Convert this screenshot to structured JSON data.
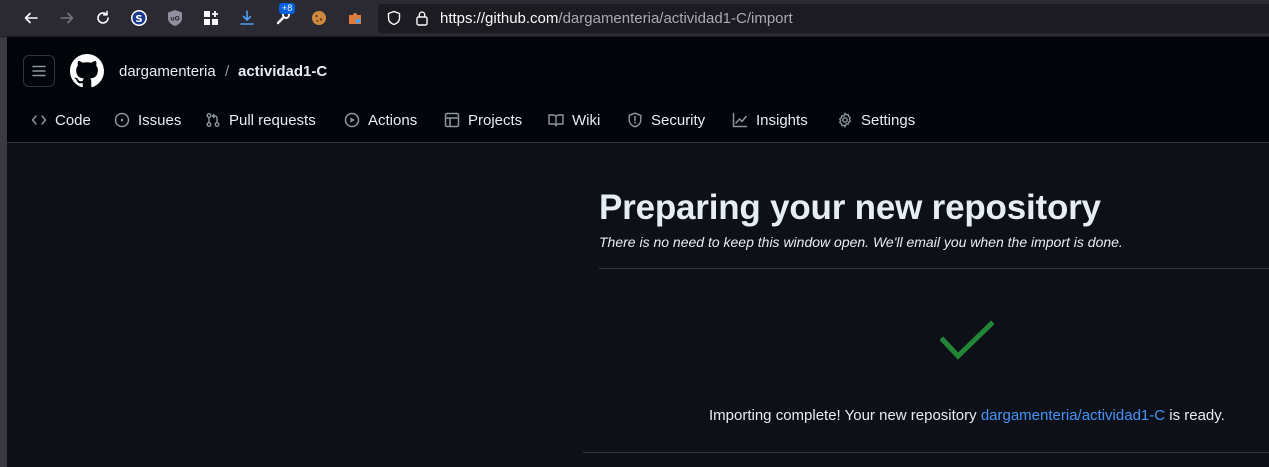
{
  "browser": {
    "url_host": "https://github.com",
    "url_path": "/dargamenteria/actividad1-C/import",
    "extensions_badge": "+8"
  },
  "repo": {
    "owner": "dargamenteria",
    "separator": "/",
    "name": "actividad1-C"
  },
  "tabs": [
    {
      "label": "Code",
      "icon": "code-icon"
    },
    {
      "label": "Issues",
      "icon": "issue-icon"
    },
    {
      "label": "Pull requests",
      "icon": "pull-request-icon"
    },
    {
      "label": "Actions",
      "icon": "play-icon"
    },
    {
      "label": "Projects",
      "icon": "table-icon"
    },
    {
      "label": "Wiki",
      "icon": "book-icon"
    },
    {
      "label": "Security",
      "icon": "shield-icon"
    },
    {
      "label": "Insights",
      "icon": "graph-icon"
    },
    {
      "label": "Settings",
      "icon": "gear-icon"
    }
  ],
  "main": {
    "title": "Preparing your new repository",
    "subtitle": "There is no need to keep this window open. We'll email you when the import is done.",
    "status_prefix": "Importing complete! Your new repository ",
    "status_link": "dargamenteria/actividad1-C",
    "status_suffix": " is ready."
  },
  "colors": {
    "background": "#0d1117",
    "header": "#010409",
    "link": "#4493f8",
    "success": "#238636"
  }
}
